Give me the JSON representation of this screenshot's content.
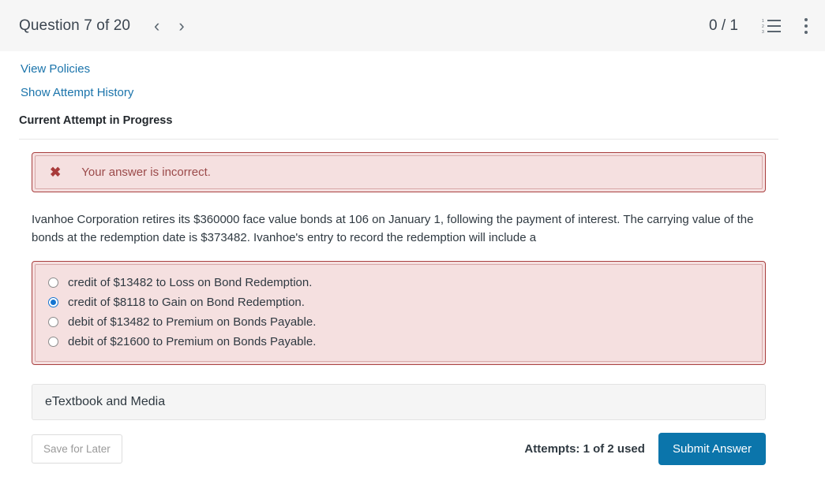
{
  "header": {
    "question_label": "Question 7 of 20",
    "prev_icon": "chevron-left-icon",
    "next_icon": "chevron-right-icon",
    "score": "0 / 1",
    "list_icon": "numbered-list-icon",
    "menu_icon": "kebab-menu-icon"
  },
  "links": {
    "view_policies": "View Policies",
    "show_attempt_history": "Show Attempt History"
  },
  "attempt": {
    "heading": "Current Attempt in Progress"
  },
  "alert": {
    "icon": "error-x-icon",
    "message": "Your answer is incorrect.",
    "border_color": "#a93f3f",
    "background_color": "#f5e0e0",
    "text_color": "#9b4a4a"
  },
  "question": {
    "text": "Ivanhoe Corporation retires its $360000 face value bonds at 106 on January 1, following the payment of interest. The carrying value of the bonds at the redemption date is $373482. Ivanhoe's entry to record the redemption will include a"
  },
  "options": [
    {
      "label": "credit of $13482 to Loss on Bond Redemption.",
      "selected": false
    },
    {
      "label": "credit of $8118 to Gain on Bond Redemption.",
      "selected": true
    },
    {
      "label": "debit of $13482 to Premium on Bonds Payable.",
      "selected": false
    },
    {
      "label": "debit of $21600 to Premium on Bonds Payable.",
      "selected": false
    }
  ],
  "etextbook": {
    "label": "eTextbook and Media"
  },
  "footer": {
    "save_label": "Save for Later",
    "attempts": "Attempts: 1 of 2 used",
    "submit_label": "Submit Answer",
    "submit_color": "#0b75ab"
  }
}
